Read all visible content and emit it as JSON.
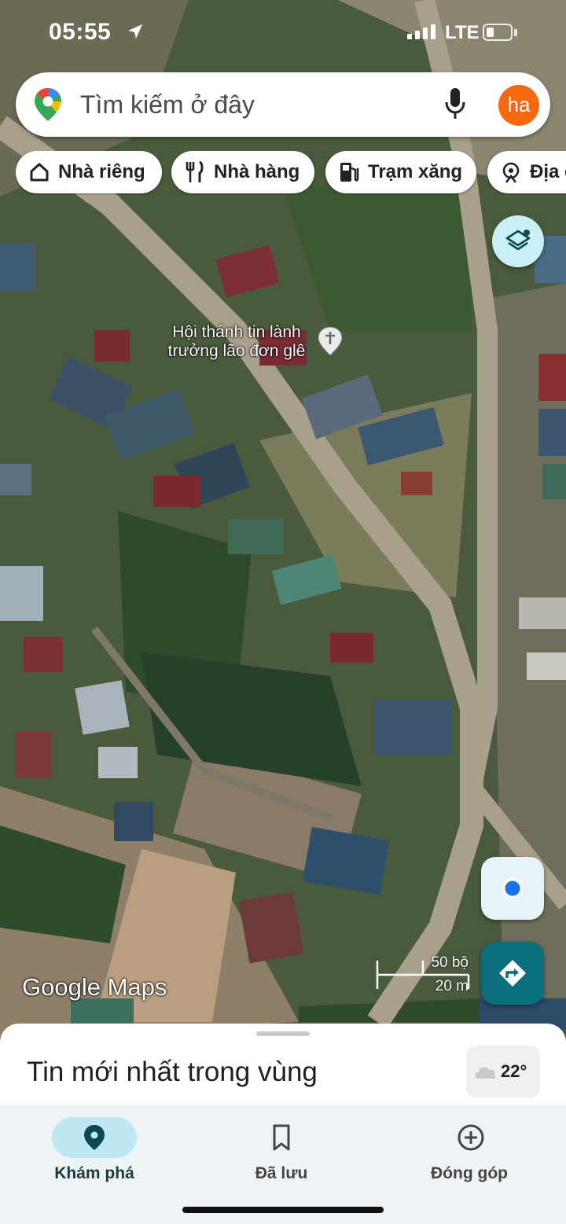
{
  "status_bar": {
    "time": "05:55",
    "network": "LTE",
    "battery_level": 0.3
  },
  "search": {
    "placeholder": "Tìm kiếm ở đây",
    "avatar_initials": "ha",
    "avatar_color": "#f4690f"
  },
  "chips": [
    {
      "label": "Nhà riêng",
      "icon": "home-icon"
    },
    {
      "label": "Nhà hàng",
      "icon": "restaurant-icon"
    },
    {
      "label": "Trạm xăng",
      "icon": "gas-station-icon"
    },
    {
      "label": "Địa điểm",
      "icon": "attraction-icon"
    }
  ],
  "map": {
    "poi_label": "Hội thánh tin lành trưởng lão đơn glê",
    "logo_text": "Google Maps",
    "scale_imperial": "50 bộ",
    "scale_metric": "20 m"
  },
  "sheet": {
    "title": "Tin mới nhất trong vùng",
    "temperature": "22°"
  },
  "bottom_nav": [
    {
      "label": "Khám phá",
      "icon": "explore-pin-icon",
      "active": true
    },
    {
      "label": "Đã lưu",
      "icon": "bookmark-icon",
      "active": false
    },
    {
      "label": "Đóng góp",
      "icon": "add-circle-icon",
      "active": false
    }
  ],
  "colors": {
    "accent": "#0a6e7c",
    "active_pill": "#bfe8f3",
    "location_dot": "#1a73e8"
  }
}
